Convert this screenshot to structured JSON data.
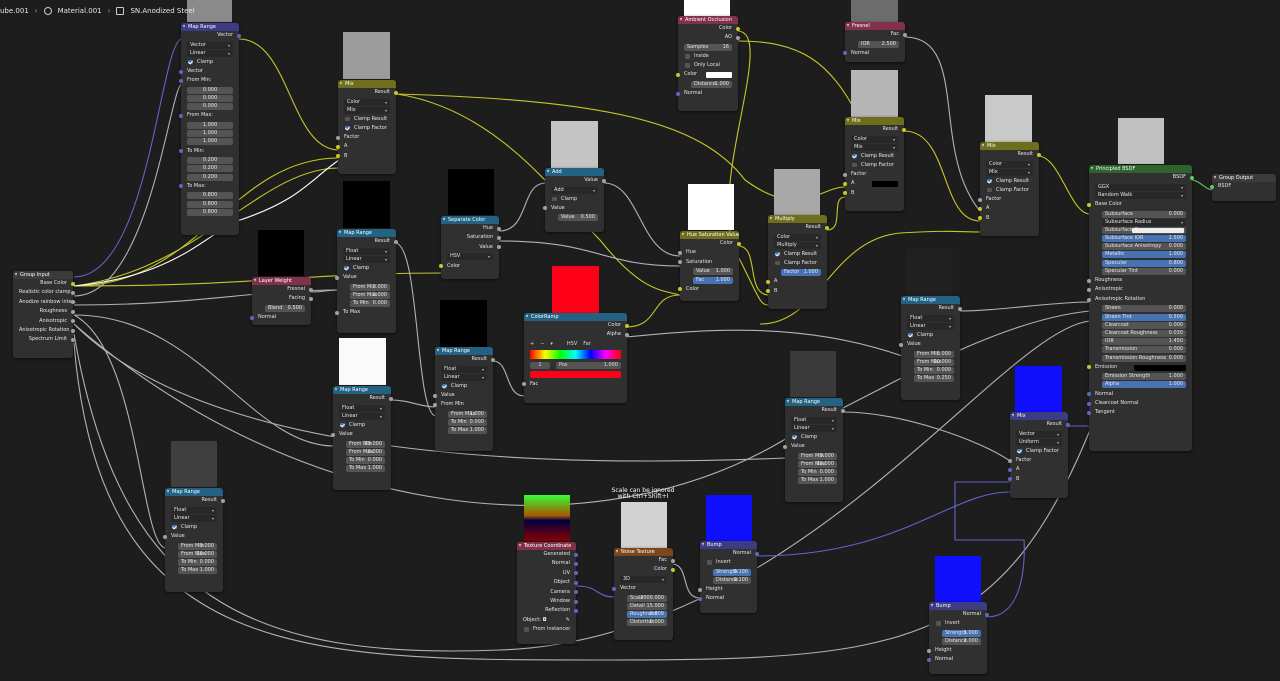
{
  "breadcrumbs": {
    "object": "ube.001",
    "material": "Material.001",
    "group": "SN.Anodized Steel"
  },
  "comment": "Scale can be ignored\nwith Ctrl+Shift+I",
  "colors": {
    "accent": "#4772b3",
    "vector_header": "#3c3c83",
    "converter_header": "#246283",
    "color_header": "#6e6e1d",
    "shader_header": "#2b652b",
    "input_header": "#83314a",
    "texture_header": "#79461d"
  },
  "nodes": {
    "vecMap": {
      "title": "Map Range",
      "out": "Vector",
      "type": "Vector",
      "interp": "Linear",
      "clamp": "Clamp",
      "vector": "Vector",
      "from_min": "From Min:",
      "from_min_v": [
        "0.000",
        "0.000",
        "0.000"
      ],
      "from_max": "From Max:",
      "from_max_v": [
        "1.000",
        "1.000",
        "1.000"
      ],
      "to_min": "To Min:",
      "to_min_v": [
        "0.200",
        "0.200",
        "0.200"
      ],
      "to_max": "To Max:",
      "to_max_v": [
        "0.800",
        "0.800",
        "0.800"
      ]
    },
    "groupIn": {
      "title": "Group Input",
      "s1": "Base Color",
      "s2": "Realistic color clamp",
      "s3": "Anodize rainbow inte...",
      "s4": "Roughness",
      "s5": "Anisotropic",
      "s6": "Anisotropic Rotation",
      "s7": "Spectrum Limit"
    },
    "mix1": {
      "title": "Mix",
      "out": "Result",
      "type": "Color",
      "mode": "Mix",
      "clamp_result": "Clamp Result",
      "clamp_factor": "Clamp Factor",
      "factor": "Factor",
      "a": "A",
      "b": "B"
    },
    "layerW": {
      "title": "Layer Weight",
      "fresnel": "Fresnel",
      "facing": "Facing",
      "blend": "Blend",
      "blend_v": "0.500",
      "normal": "Normal"
    },
    "mr2": {
      "title": "Map Range",
      "out": "Result",
      "type": "Float",
      "interp": "Linear",
      "clamp": "Clamp",
      "value": "Value",
      "fmin": "From Min",
      "fmin_v": "0.000",
      "fmax": "From Max",
      "fmax_v": "1.000",
      "tmin": "To Min",
      "tmin_v": "0.000",
      "tmax": "To Max"
    },
    "mr3": {
      "title": "Map Range",
      "out": "Result",
      "type": "Float",
      "interp": "Linear",
      "clamp": "Clamp",
      "value": "Value",
      "fmin": "From Min",
      "fmin_v": "20.000",
      "fmax": "From Max",
      "fmax_v": "0.000",
      "tmin": "To Min",
      "tmin_v": "0.000",
      "tmax": "To Max",
      "tmax_v": "1.000"
    },
    "mr4": {
      "title": "Map Range",
      "out": "Result",
      "type": "Float",
      "interp": "Linear",
      "clamp": "Clamp",
      "value": "Value",
      "fmin": "From Min",
      "fmin_v": "0.000",
      "fmax": "From Max",
      "fmax_v": "20.000",
      "tmin": "To Min",
      "tmin_v": "0.000",
      "tmax": "To Max",
      "tmax_v": "1.000"
    },
    "sepCol": {
      "title": "Separate Color",
      "hue": "Hue",
      "sat": "Saturation",
      "val": "Value",
      "mode": "HSV",
      "color": "Color"
    },
    "mr5": {
      "title": "Map Range",
      "out": "Result",
      "type": "Float",
      "interp": "Linear",
      "clamp": "Clamp",
      "value": "Value",
      "fmin": "From Min",
      "fmax": "From Max",
      "fmax_v": "1.000",
      "tmin": "To Min",
      "tmin_v": "0.000",
      "tmax": "To Max",
      "tmax_v": "1.000"
    },
    "add": {
      "title": "Add",
      "out": "Value",
      "op": "Add",
      "clamp": "Clamp",
      "value": "Value",
      "value2": "Value",
      "value2_v": "0.500"
    },
    "ramp": {
      "title": "ColorRamp",
      "color": "Color",
      "alpha": "Alpha",
      "plus": "+",
      "minus": "−",
      "mode": "HSV",
      "interp": "Far",
      "idx": "1",
      "pos": "Pos",
      "pos_v": "1.000",
      "fac": "Fac"
    },
    "ao": {
      "title": "Ambient Occlusion",
      "color": "Color",
      "ao": "AO",
      "samples": "Samples",
      "samples_v": "16",
      "inside": "Inside",
      "only_local": "Only Local",
      "color_in": "Color",
      "distance": "Distance",
      "distance_v": "1.000",
      "normal": "Normal"
    },
    "hsv": {
      "title": "Hue Saturation Value",
      "color": "Color",
      "hue": "Hue",
      "sat": "Saturation",
      "value": "Value",
      "value_v": "1.000",
      "fac": "Fac",
      "fac_v": "1.000",
      "color_in": "Color"
    },
    "multiply": {
      "title": "Multiply",
      "out": "Result",
      "type": "Color",
      "mode": "Multiply",
      "clamp_result": "Clamp Result",
      "clamp_factor": "Clamp Factor",
      "factor": "Factor",
      "factor_v": "1.000",
      "a": "A",
      "b": "B"
    },
    "fresnel": {
      "title": "Fresnel",
      "fac": "Fac",
      "ior": "IOR",
      "ior_v": "2.500",
      "normal": "Normal"
    },
    "mix2": {
      "title": "Mix",
      "out": "Result",
      "type": "Color",
      "mode": "Mix",
      "clamp_result": "Clamp Result",
      "clamp_factor": "Clamp Factor",
      "factor": "Factor",
      "a": "A",
      "b": "B"
    },
    "mix3": {
      "title": "Mix",
      "out": "Result",
      "type": "Color",
      "mode": "Mix",
      "clamp_result": "Clamp Result",
      "clamp_factor": "Clamp Factor",
      "factor": "Factor",
      "a": "A",
      "b": "B"
    },
    "mr6": {
      "title": "Map Range",
      "out": "Result",
      "type": "Float",
      "interp": "Linear",
      "clamp": "Clamp",
      "value": "Value",
      "fmin": "From Min",
      "fmin_v": "0.000",
      "fmax": "From Max",
      "fmax_v": "20.000",
      "tmin": "To Min",
      "tmin_v": "0.000",
      "tmax": "To Max",
      "tmax_v": "0.250"
    },
    "mr7": {
      "title": "Map Range",
      "out": "Result",
      "type": "Float",
      "interp": "Linear",
      "clamp": "Clamp",
      "value": "Value",
      "fmin": "From Min",
      "fmin_v": "0.000",
      "fmax": "From Max",
      "fmax_v": "20.000",
      "tmin": "To Min",
      "tmin_v": "0.000",
      "tmax": "To Max",
      "tmax_v": "1.000"
    },
    "mr8": {
      "title": "Map Range",
      "out": "Result",
      "type": "Float",
      "interp": "Linear",
      "clamp": "Clamp",
      "value": "Value",
      "fmin": "From Min",
      "fmin_v": "0.000",
      "fmax": "From Max",
      "fmax_v": "20.000",
      "tmin": "To Min",
      "tmin_v": "0.000",
      "tmax": "To Max",
      "tmax_v": "1.000"
    },
    "texCoord": {
      "title": "Texture Coordinate",
      "generated": "Generated",
      "normal": "Normal",
      "uv": "UV",
      "object": "Object",
      "camera": "Camera",
      "window": "Window",
      "reflection": "Reflection",
      "object_f": "Object:",
      "from_inst": "From Instancer"
    },
    "noise": {
      "title": "Noise Texture",
      "fac": "Fac",
      "color": "Color",
      "dim": "3D",
      "vector": "Vector",
      "scale": "Scale",
      "scale_v": "2000.000",
      "detail": "Detail",
      "detail_v": "15.000",
      "rough": "Roughness",
      "rough_v": "0.809",
      "dist": "Distortion",
      "dist_v": "0.000"
    },
    "bump1": {
      "title": "Bump",
      "normal": "Normal",
      "invert": "Invert",
      "strength": "Strength",
      "strength_v": "0.100",
      "distance": "Distance",
      "distance_v": "0.100",
      "height": "Height",
      "normal_in": "Normal"
    },
    "bump2": {
      "title": "Bump",
      "normal": "Normal",
      "invert": "Invert",
      "strength": "Strength",
      "strength_v": "1.000",
      "distance": "Distance",
      "distance_v": "1.000",
      "height": "Height",
      "normal_in": "Normal"
    },
    "mixVec": {
      "title": "Mix",
      "out": "Result",
      "type": "Vector",
      "mode": "Uniform",
      "clamp_factor": "Clamp Factor",
      "factor": "Factor",
      "a": "A",
      "b": "B"
    },
    "bsdf": {
      "title": "Principled BSDF",
      "out": "BSDF",
      "dist": "GGX",
      "sss": "Random Walk",
      "base_color": "Base Color",
      "fields": [
        {
          "l": "Subsurface",
          "v": "0.000",
          "b": false
        },
        {
          "l": "Subsurface Radius",
          "v": "",
          "b": false,
          "sel": true
        },
        {
          "l": "Subsurface C...",
          "v": "",
          "b": false,
          "sw": true
        },
        {
          "l": "Subsurface IOR",
          "v": "2.500",
          "b": true
        },
        {
          "l": "Subsurface Anisotropy",
          "v": "0.000",
          "b": false
        },
        {
          "l": "Metallic",
          "v": "1.000",
          "b": true
        },
        {
          "l": "Specular",
          "v": "0.800",
          "b": true
        },
        {
          "l": "Specular Tint",
          "v": "0.000",
          "b": false
        }
      ],
      "roughness": "Roughness",
      "anisotropic": "Anisotropic",
      "aniso_rot": "Anisotropic Rotation",
      "fields2": [
        {
          "l": "Sheen",
          "v": "0.000",
          "b": false
        },
        {
          "l": "Sheen Tint",
          "v": "0.500",
          "b": true
        },
        {
          "l": "Clearcoat",
          "v": "0.000",
          "b": false
        },
        {
          "l": "Clearcoat Roughness",
          "v": "0.030",
          "b": false
        },
        {
          "l": "IOR",
          "v": "1.450",
          "b": false
        },
        {
          "l": "Transmission",
          "v": "0.000",
          "b": false
        },
        {
          "l": "Transmission Roughness",
          "v": "0.000",
          "b": false
        }
      ],
      "emission": "Emission",
      "emission_strength": "Emission Strength",
      "emission_strength_v": "1.000",
      "alpha": "Alpha",
      "alpha_v": "1.000",
      "normal": "Normal",
      "clearcoat_normal": "Clearcoat Normal",
      "tangent": "Tangent"
    },
    "groupOut": {
      "title": "Group Output",
      "bsdf": "BSDF"
    }
  }
}
